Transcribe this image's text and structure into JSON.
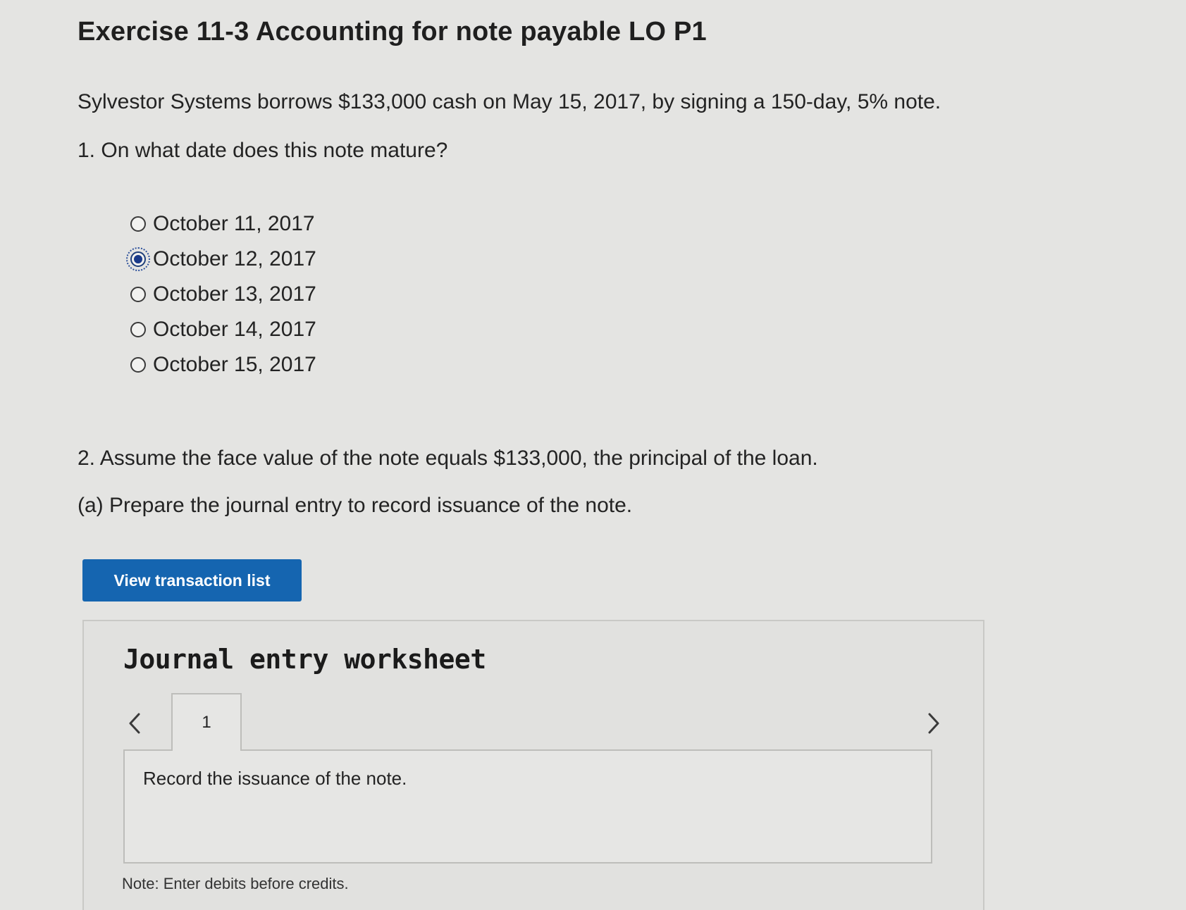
{
  "exercise": {
    "title": "Exercise 11-3 Accounting for note payable LO P1",
    "intro": "Sylvestor Systems borrows $133,000 cash on May 15, 2017, by signing a 150-day, 5% note."
  },
  "question1": {
    "prompt": "1. On what date does this note mature?",
    "options": [
      {
        "label": "October 11, 2017",
        "selected": false
      },
      {
        "label": "October 12, 2017",
        "selected": true
      },
      {
        "label": "October 13, 2017",
        "selected": false
      },
      {
        "label": "October 14, 2017",
        "selected": false
      },
      {
        "label": "October 15, 2017",
        "selected": false
      }
    ]
  },
  "question2": {
    "prompt": "2. Assume the face value of the note equals $133,000, the principal of the loan.",
    "part_a": "(a) Prepare the journal entry to record issuance of the note."
  },
  "buttons": {
    "view_transaction_list": "View transaction list"
  },
  "worksheet": {
    "title": "Journal entry worksheet",
    "active_tab": "1",
    "instruction": "Record the issuance of the note.",
    "note": "Note: Enter debits before credits."
  },
  "colors": {
    "primary_button": "#1565b0",
    "background": "#e4e4e2",
    "selected_radio": "#1a3a8a"
  },
  "icons": {
    "prev": "chevron-left-icon",
    "next": "chevron-right-icon"
  }
}
